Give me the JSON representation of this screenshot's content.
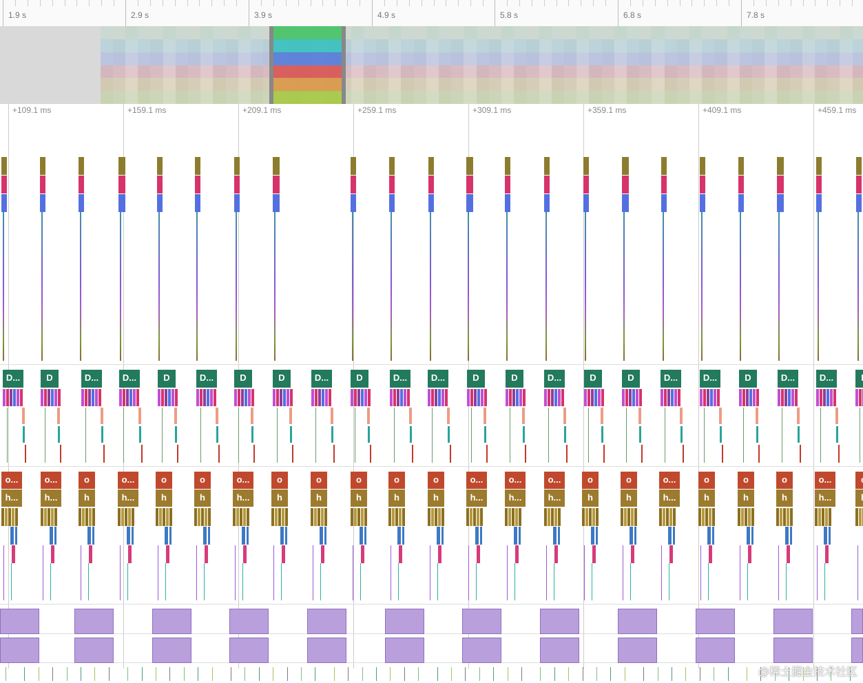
{
  "ruler": {
    "labels": [
      "1.9 s",
      "2.9 s",
      "3.9 s",
      "4.9 s",
      "5.8 s",
      "6.8 s",
      "7.8 s"
    ]
  },
  "detail_ruler": {
    "labels": [
      "+109.1 ms",
      "+159.1 ms",
      "+209.1 ms",
      "+259.1 ms",
      "+309.1 ms",
      "+359.1 ms",
      "+409.1 ms",
      "+459.1 ms"
    ]
  },
  "track2_labels": [
    "D...",
    "D",
    "D...",
    "D...",
    "D",
    "D...",
    "D",
    "D",
    "D...",
    "D",
    "D...",
    "D...",
    "D",
    "D",
    "D...",
    "D",
    "D",
    "D...",
    "D...",
    "D",
    "D...",
    "D...",
    "D"
  ],
  "track3_top": [
    "o...",
    "o...",
    "o",
    "o...",
    "o",
    "o",
    "o...",
    "o",
    "o",
    "o",
    "o",
    "o",
    "o...",
    "o...",
    "o...",
    "o",
    "o",
    "o...",
    "o",
    "o",
    "o",
    "o...",
    "o"
  ],
  "track3_sub": [
    "h...",
    "h...",
    "h",
    "h...",
    "h",
    "h",
    "h...",
    "h",
    "h",
    "h",
    "h",
    "h",
    "h...",
    "h...",
    "h...",
    "h",
    "h",
    "h...",
    "h",
    "h",
    "h",
    "h...",
    "h"
  ],
  "colors": {
    "olive": "#8c7d2e",
    "magenta": "#d6336c",
    "blue": "#5470e0",
    "teal_green": "#237a5c",
    "rust": "#c0492d",
    "khaki": "#9c7b2f",
    "purple_fill": "#b9a0dc"
  },
  "watermark": "@稀土掘金技术社区"
}
